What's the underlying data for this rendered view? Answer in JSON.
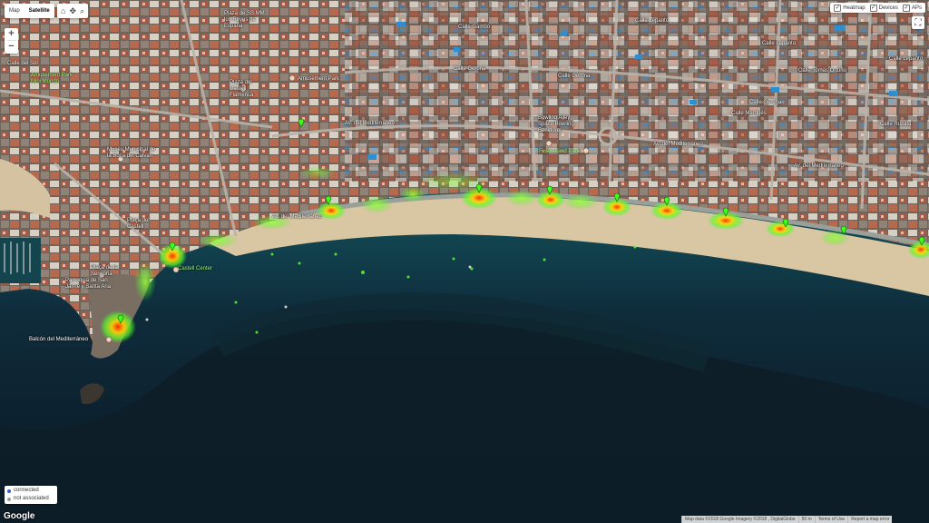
{
  "map_type": {
    "map": "Map",
    "satellite": "Satellite"
  },
  "tools": {
    "home_icon": "home-icon",
    "pan_icon": "pan-icon",
    "search_icon": "search-icon"
  },
  "zoom": {
    "in": "+",
    "out": "−"
  },
  "layers": {
    "heatmap": "Heatmap",
    "devices": "Devices",
    "aps": "APs"
  },
  "legend": {
    "connected": "connected",
    "not_associated": "not associated",
    "connected_color": "#3b5bd6",
    "not_associated_color": "#9a9a9a"
  },
  "logo": "Google",
  "attribution": {
    "map_data": "Map data ©2018 Google Imagery ©2018 , DigitalGlobe",
    "scale": "50 m",
    "terms": "Terms of Use",
    "report": "Report a map error"
  },
  "place_labels": {
    "calle_del_sol": "Calle del Sol",
    "plaza_reyes": "Plaza de SS.MM.\nlos Reyes de\nEspaña",
    "amusement_park_city": "Amusement Park\nMini Mundo",
    "calle_gerona_1": "Calle Gerona",
    "calle_gerona_2": "Calle Gerona",
    "calle_gerona_3": "Calle Gerona",
    "plaza_flamenca": "Plaza del\nCastell\nFlamenca",
    "amusement_park": "Amusement Park",
    "calle_lepanto_1": "Calle Lepanto",
    "calle_lepanto_2": "Calle Lepanto",
    "calle_lepanto_3": "Calle Lepanto",
    "av_mediterraneo_1": "Av. del Mediterráneo",
    "av_mediterraneo_2": "Av. del Mediterráneo",
    "av_mediterraneo_3": "Av. del Mediterráneo",
    "av_mediterraneo_4": "Av. del Mediterráneo",
    "museo": "Museu Municipal de\nla Boca del Calvari",
    "bowling": "Bowling Alley\nSpace Bowling\nBenidorm",
    "festivaland": "Festivaland Park",
    "calle_oeste": "Calle Ruzafa",
    "placa_senyoria": "Plaça de la\nSenyoria",
    "parroquia": "Parroquia de San\nJaime y Santa Ana",
    "castell_center": "Castell Center",
    "balcon": "Balcón del Mediterráneo",
    "placa_castell": "Plaça del\nCastell",
    "calle_gambo": "Calle Gambo",
    "calle_tomas": "Calle Tomás Ortuño",
    "calle_marqués": "Calle Marqués"
  }
}
